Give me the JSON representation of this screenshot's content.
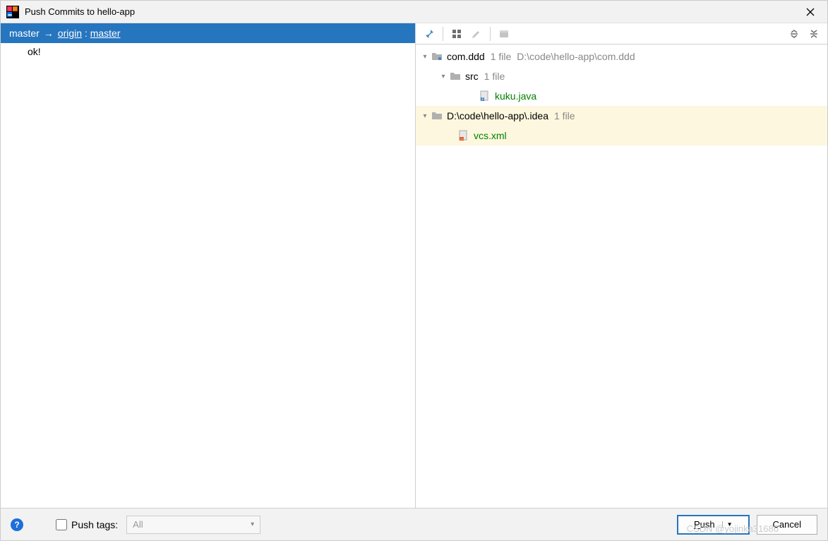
{
  "title": "Push Commits to hello-app",
  "branch": {
    "local": "master",
    "remote": "origin",
    "remoteBranch": "master"
  },
  "commits": [
    "ok!"
  ],
  "tree": {
    "root1": {
      "name": "com.ddd",
      "count": "1 file",
      "path": "D:\\code\\hello-app\\com.ddd"
    },
    "src": {
      "name": "src",
      "count": "1 file"
    },
    "file1": {
      "name": "kuku.java"
    },
    "root2": {
      "name": "D:\\code\\hello-app\\.idea",
      "count": "1 file"
    },
    "file2": {
      "name": "vcs.xml"
    }
  },
  "bottom": {
    "pushTagsLabel": "Push tags:",
    "tagMode": "All",
    "pushLabel": "Push",
    "cancelLabel": "Cancel"
  },
  "watermark": "CSDN @yojinka31686"
}
